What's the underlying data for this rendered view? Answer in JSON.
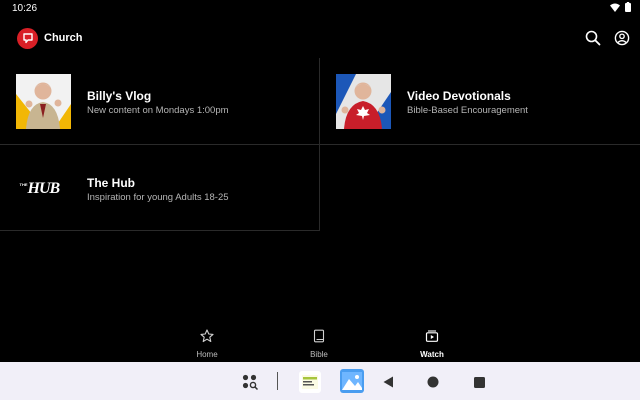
{
  "status": {
    "time": "10:26"
  },
  "app": {
    "title": "Church",
    "logo_icon": "chat-bubble-logo-icon",
    "accent": "#d81f26"
  },
  "header": {
    "search_icon": "search-icon",
    "account_icon": "account-circle-icon"
  },
  "tiles": [
    {
      "title": "Billy's Vlog",
      "subtitle": "New content on Mondays 1:00pm"
    },
    {
      "title": "Video Devotionals",
      "subtitle": "Bible-Based Encouragement"
    },
    {
      "title": "The Hub",
      "subtitle": "Inspiration for young Adults 18-25",
      "logo_text": "HUB",
      "logo_small": "THE"
    }
  ],
  "nav": {
    "items": [
      {
        "label": "Home",
        "icon": "star-icon"
      },
      {
        "label": "Bible",
        "icon": "book-icon"
      },
      {
        "label": "Watch",
        "icon": "video-library-icon"
      }
    ],
    "active": "Watch"
  }
}
